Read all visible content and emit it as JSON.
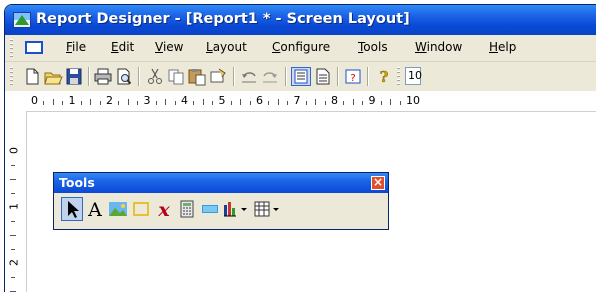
{
  "window": {
    "title": "Report Designer - [Report1 * - Screen Layout]",
    "title_bar_color": "#0a49d6"
  },
  "menubar": {
    "items": [
      {
        "label": "File"
      },
      {
        "label": "Edit"
      },
      {
        "label": "View"
      },
      {
        "label": "Layout"
      },
      {
        "label": "Configure"
      },
      {
        "label": "Tools"
      },
      {
        "label": "Window"
      },
      {
        "label": "Help"
      }
    ]
  },
  "toolbar": {
    "buttons": [
      {
        "icon": "new-icon"
      },
      {
        "icon": "open-icon"
      },
      {
        "icon": "save-icon"
      },
      {
        "icon": "print-icon"
      },
      {
        "icon": "print-preview-icon"
      },
      {
        "icon": "cut-icon"
      },
      {
        "icon": "copy-icon"
      },
      {
        "icon": "paste-icon"
      },
      {
        "icon": "format-painter-icon"
      },
      {
        "icon": "undo-icon"
      },
      {
        "icon": "redo-icon"
      },
      {
        "icon": "layout-view-icon",
        "active": true
      },
      {
        "icon": "page-view-icon"
      },
      {
        "icon": "properties-icon"
      },
      {
        "icon": "help-icon"
      }
    ],
    "zoom_value": "10"
  },
  "ruler": {
    "horizontal_labels": [
      "0",
      "1",
      "2",
      "3",
      "4",
      "5",
      "6",
      "7",
      "8",
      "9",
      "10"
    ],
    "vertical_labels": [
      "0",
      "1",
      "2"
    ]
  },
  "tools_palette": {
    "title": "Tools",
    "tools": [
      {
        "icon": "pointer-icon",
        "active": true
      },
      {
        "icon": "text-icon"
      },
      {
        "icon": "image-icon"
      },
      {
        "icon": "rectangle-icon"
      },
      {
        "icon": "formula-icon"
      },
      {
        "icon": "calculator-icon"
      },
      {
        "icon": "barcode-icon"
      },
      {
        "icon": "chart-icon"
      },
      {
        "icon": "table-icon"
      }
    ]
  }
}
